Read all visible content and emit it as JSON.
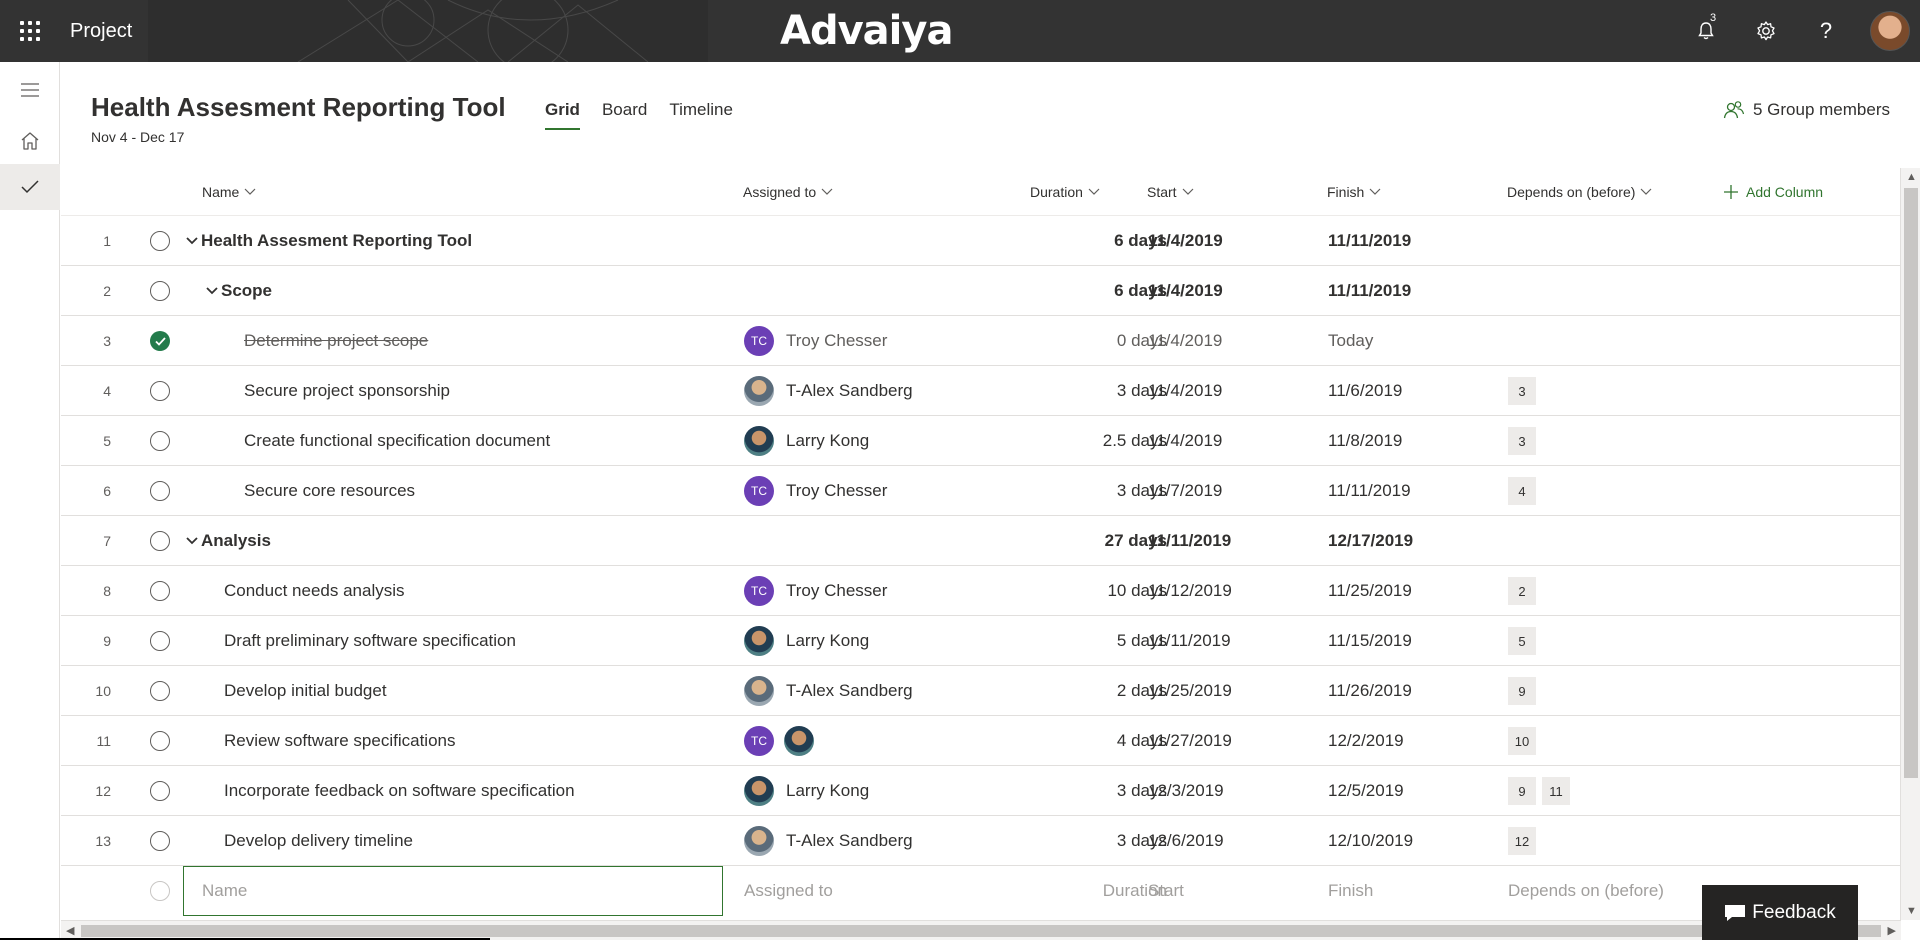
{
  "topbar": {
    "app_name": "Project",
    "brand": "Advaiya",
    "notification_count": "3",
    "icons": [
      "waffle-icon",
      "bell-icon",
      "gear-icon",
      "help-icon"
    ]
  },
  "leftrail": {
    "items": [
      "menu-icon",
      "home-icon",
      "check-icon"
    ]
  },
  "header": {
    "title": "Health Assesment Reporting Tool",
    "dates": "Nov 4 - Dec 17",
    "tabs": [
      {
        "label": "Grid",
        "active": true
      },
      {
        "label": "Board",
        "active": false
      },
      {
        "label": "Timeline",
        "active": false
      }
    ],
    "members": "5 Group members"
  },
  "columns": {
    "name": "Name",
    "assigned": "Assigned to",
    "duration": "Duration",
    "start": "Start",
    "finish": "Finish",
    "depends": "Depends on (before)",
    "add_column": "Add Column"
  },
  "rows": [
    {
      "num": "1",
      "name": "Health Assesment Reporting Tool",
      "duration": "6 days",
      "start": "11/4/2019",
      "finish": "11/11/2019",
      "summary": true
    },
    {
      "num": "2",
      "name": "Scope",
      "duration": "6 days",
      "start": "11/4/2019",
      "finish": "11/11/2019",
      "summary": true
    },
    {
      "num": "3",
      "name": "Determine project scope",
      "assigned": "Troy Chesser",
      "initials": "TC",
      "duration": "0 days",
      "start": "11/4/2019",
      "finish": "Today",
      "completed": true
    },
    {
      "num": "4",
      "name": "Secure project sponsorship",
      "assigned": "T-Alex Sandberg",
      "duration": "3 days",
      "start": "11/4/2019",
      "finish": "11/6/2019",
      "depends": [
        "3"
      ]
    },
    {
      "num": "5",
      "name": "Create functional specification document",
      "assigned": "Larry Kong",
      "duration": "2.5 days",
      "start": "11/4/2019",
      "finish": "11/8/2019",
      "depends": [
        "3"
      ]
    },
    {
      "num": "6",
      "name": "Secure core resources",
      "assigned": "Troy Chesser",
      "initials": "TC",
      "duration": "3 days",
      "start": "11/7/2019",
      "finish": "11/11/2019",
      "depends": [
        "4"
      ]
    },
    {
      "num": "7",
      "name": "Analysis",
      "duration": "27 days",
      "start": "11/11/2019",
      "finish": "12/17/2019",
      "summary": true
    },
    {
      "num": "8",
      "name": "Conduct needs analysis",
      "assigned": "Troy Chesser",
      "initials": "TC",
      "duration": "10 days",
      "start": "11/12/2019",
      "finish": "11/25/2019",
      "depends": [
        "2"
      ]
    },
    {
      "num": "9",
      "name": "Draft preliminary software specification",
      "assigned": "Larry Kong",
      "duration": "5 days",
      "start": "11/11/2019",
      "finish": "11/15/2019",
      "depends": [
        "5"
      ]
    },
    {
      "num": "10",
      "name": "Develop initial budget",
      "assigned": "T-Alex Sandberg",
      "duration": "2 days",
      "start": "11/25/2019",
      "finish": "11/26/2019",
      "depends": [
        "9"
      ]
    },
    {
      "num": "11",
      "name": "Review software specifications",
      "initials": "TC",
      "duration": "4 days",
      "start": "11/27/2019",
      "finish": "12/2/2019",
      "depends": [
        "10"
      ]
    },
    {
      "num": "12",
      "name": "Incorporate feedback on software specification",
      "assigned": "Larry Kong",
      "duration": "3 days",
      "start": "12/3/2019",
      "finish": "12/5/2019",
      "depends": [
        "9",
        "11"
      ]
    },
    {
      "num": "13",
      "name": "Develop delivery timeline",
      "assigned": "T-Alex Sandberg",
      "duration": "3 days",
      "start": "12/6/2019",
      "finish": "12/10/2019",
      "depends": [
        "12"
      ]
    }
  ],
  "new_row": {
    "name_placeholder": "Name",
    "assigned_placeholder": "Assigned to",
    "duration_placeholder": "Duration",
    "start_placeholder": "Start",
    "finish_placeholder": "Finish",
    "depends_placeholder": "Depends on (before)"
  },
  "feedback": "Feedback",
  "colors": {
    "accent": "#31752f",
    "topbar": "#333333",
    "tc_avatar": "#6b3fb5",
    "complete": "#237b4b"
  }
}
